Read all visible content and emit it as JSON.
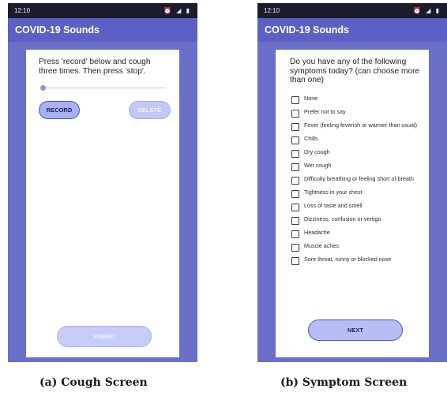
{
  "screens": [
    {
      "status_time": "12:10",
      "status_icons": "⏰ ◢ ▮",
      "app_title": "COVID-19 Sounds",
      "prompt": "Press 'record' below and cough three times. Then press 'stop'.",
      "progress": 0.0,
      "record_label": "RECORD",
      "delete_label": "DELETE",
      "submit_label": "SUBMIT"
    },
    {
      "status_time": "12:10",
      "status_icons": "⏰ ◢ ▮",
      "app_title": "COVID-19 Sounds",
      "question": "Do you have any of the following symptoms today? (can choose more than one)",
      "symptoms": [
        "None",
        "Prefer not to say",
        "Fever (feeling feverish or warmer than usual)",
        "Chills",
        "Dry cough",
        "Wet cough",
        "Difficulty breathing or feeling short of breath",
        "Tightness in your chest",
        "Loss of taste and smell",
        "Dizziness, confusion or vertigo",
        "Headache",
        "Muscle aches",
        "Sore throat, runny or blocked nose"
      ],
      "next_label": "NEXT"
    }
  ],
  "captions": [
    "(a) Cough Screen",
    "(b) Symptom Screen"
  ],
  "colors": {
    "background": "#6a6fc9",
    "app_bar": "#5b60c2",
    "status_bar": "#1b1c2e",
    "button": "#a9b0f5"
  }
}
